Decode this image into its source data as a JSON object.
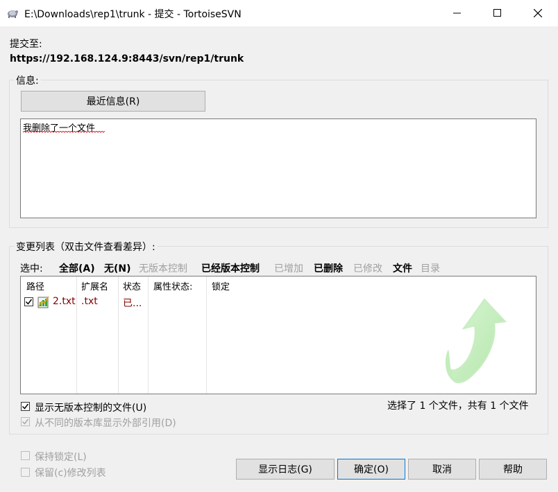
{
  "window": {
    "title": "E:\\Downloads\\rep1\\trunk - 提交 - TortoiseSVN"
  },
  "commit_to": {
    "label": "提交至:",
    "url": "https://192.168.124.9:8443/svn/rep1/trunk"
  },
  "message": {
    "group_label": "信息:",
    "recent_button": "最近信息(R)",
    "text": "我删除了一个文件"
  },
  "changes": {
    "group_label": "变更列表（双击文件查看差异）:",
    "select_label": "选中:",
    "filters": [
      {
        "label": "全部(A)",
        "state": "bold"
      },
      {
        "label": "无(N)",
        "state": "bold"
      },
      {
        "label": "无版本控制",
        "state": "disabled"
      },
      {
        "label": "已经版本控制",
        "state": "bold"
      },
      {
        "label": "已增加",
        "state": "disabled"
      },
      {
        "label": "已删除",
        "state": "bold"
      },
      {
        "label": "已修改",
        "state": "disabled"
      },
      {
        "label": "文件",
        "state": "bold"
      },
      {
        "label": "目录",
        "state": "disabled"
      }
    ],
    "columns": [
      "路径",
      "扩展名",
      "状态",
      "属性状态:",
      "锁定"
    ],
    "rows": [
      {
        "checked": true,
        "path": "2.txt",
        "ext": ".txt",
        "status": "已...",
        "prop_status": "",
        "lock": ""
      }
    ],
    "status_color": "#800000",
    "show_unversioned": {
      "label": "显示无版本控制的文件(U)",
      "checked": true
    },
    "show_externals": {
      "label": "从不同的版本库显示外部引用(D)",
      "checked": true,
      "disabled": true
    },
    "summary": "选择了 1 个文件，共有 1 个文件"
  },
  "options": {
    "keep_locks": {
      "label": "保持锁定(L)",
      "checked": false,
      "disabled": true
    },
    "keep_changelists": {
      "label": "保留(c)修改列表",
      "checked": false,
      "disabled": true
    }
  },
  "buttons": {
    "show_log": "显示日志(G)",
    "ok": "确定(O)",
    "cancel": "取消",
    "help": "帮助"
  }
}
